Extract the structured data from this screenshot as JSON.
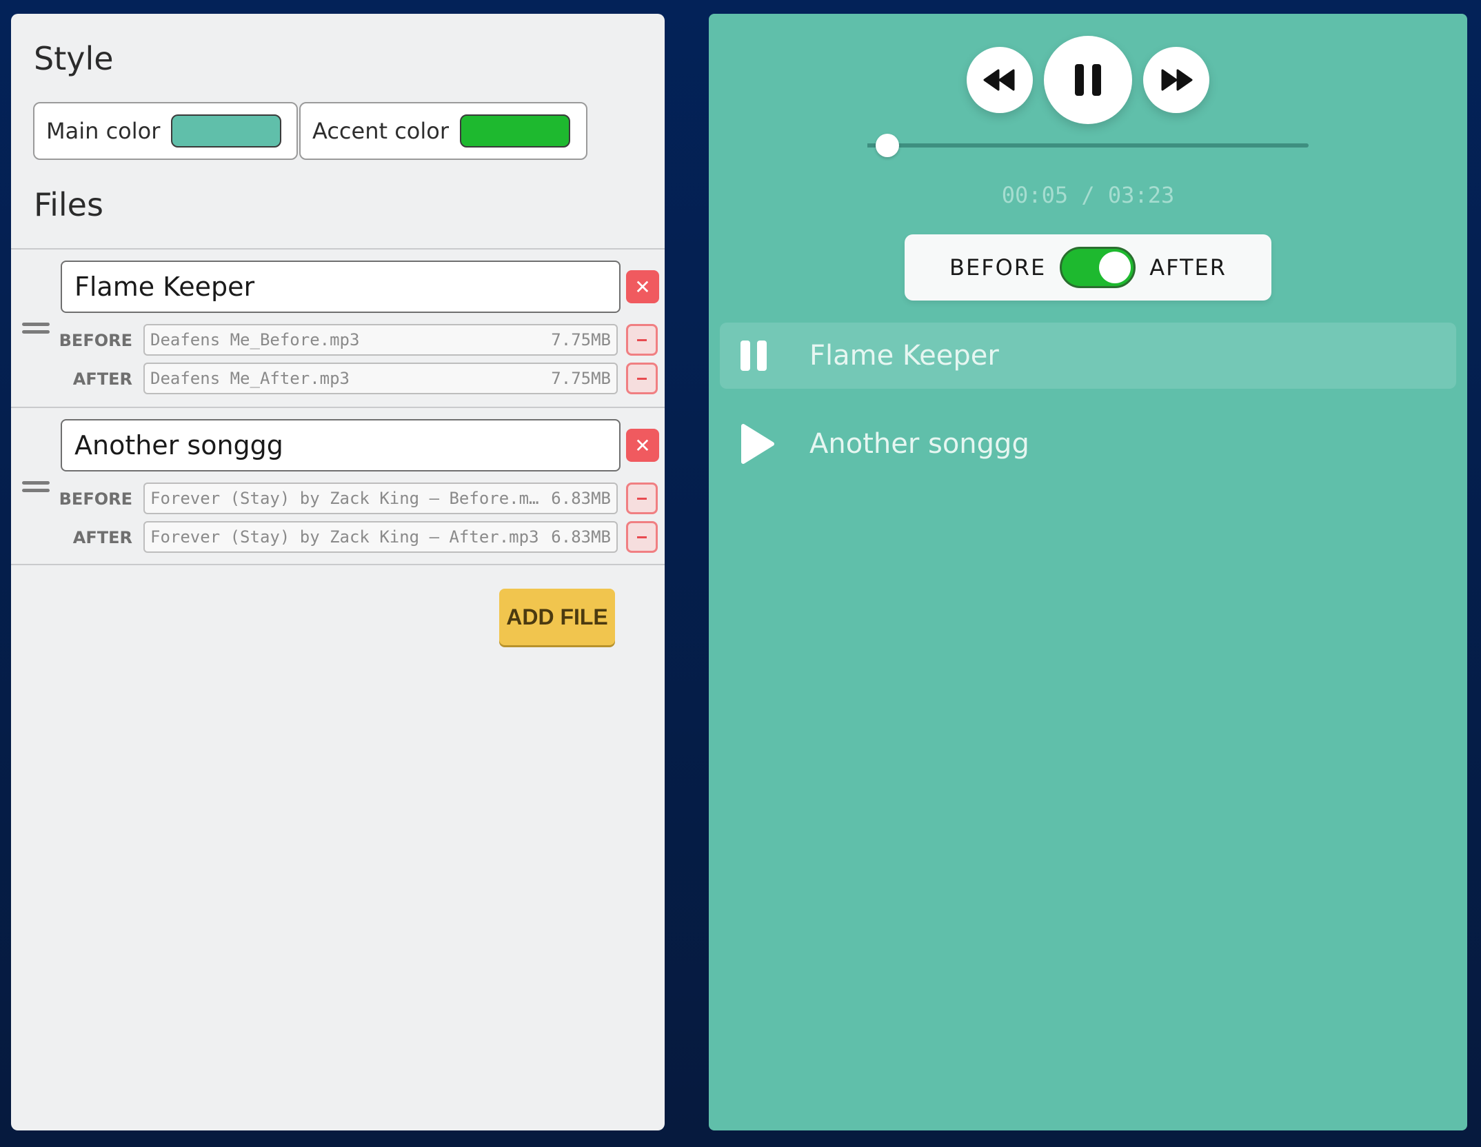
{
  "style": {
    "title": "Style",
    "main_color": {
      "label": "Main color",
      "value": "#60bfaa"
    },
    "accent_color": {
      "label": "Accent color",
      "value": "#1eb92f"
    }
  },
  "files": {
    "title": "Files",
    "groups": [
      {
        "title": "Flame Keeper",
        "before": {
          "label": "BEFORE",
          "name": "Deafens Me_Before.mp3",
          "size": "7.75MB"
        },
        "after": {
          "label": "AFTER",
          "name": "Deafens Me_After.mp3",
          "size": "7.75MB"
        }
      },
      {
        "title": "Another songgg",
        "before": {
          "label": "BEFORE",
          "name": "Forever (Stay) by Zack King – Before.m…",
          "size": "6.83MB"
        },
        "after": {
          "label": "AFTER",
          "name": "Forever (Stay) by Zack King – After.mp3",
          "size": "6.83MB"
        }
      }
    ],
    "add_label": "ADD FILE"
  },
  "player": {
    "time": "00:05 / 03:23",
    "progress_fraction": 0.046,
    "toggle": {
      "before_label": "BEFORE",
      "after_label": "AFTER",
      "state": "after"
    },
    "tracks": [
      {
        "title": "Flame Keeper",
        "state": "playing",
        "icon": "pause-icon"
      },
      {
        "title": "Another songgg",
        "state": "paused",
        "icon": "play-icon"
      }
    ],
    "controls": [
      "rewind-icon",
      "pause-icon",
      "fast-forward-icon"
    ]
  }
}
